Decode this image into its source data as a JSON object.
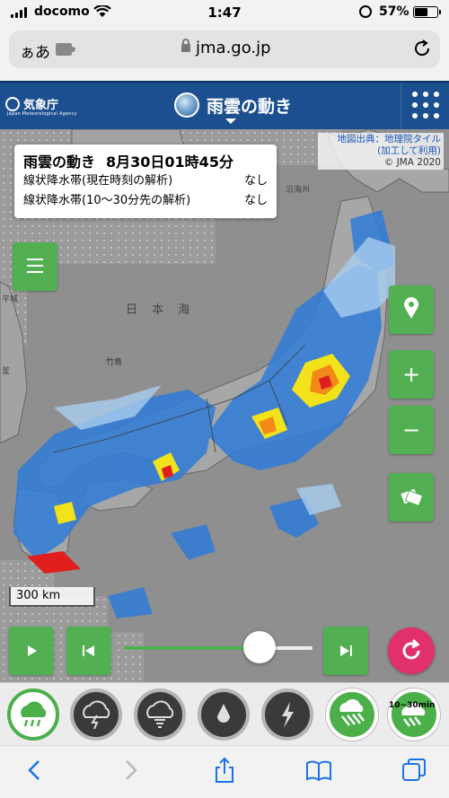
{
  "status_bar": {
    "carrier": "docomo",
    "time": "1:47",
    "battery": "57%",
    "battery_level": 0.57
  },
  "browser": {
    "text_size_label": "ぁあ",
    "domain": "jma.go.jp"
  },
  "header": {
    "agency_name": "気象庁",
    "agency_name_en": "Japan Meteorological Agency",
    "title": "雨雲の動き"
  },
  "map": {
    "attribution_line1": "地図出典：地理院タイル",
    "attribution_line2": "(加工して利用)",
    "attribution_line3": "© JMA 2020",
    "info": {
      "title": "雨雲の動き",
      "datetime": "8月30日01時45分",
      "rows": [
        {
          "label": "線状降水帯(現在時刻の解析)",
          "value": "なし"
        },
        {
          "label": "線状降水帯(10〜30分先の解析)",
          "value": "なし"
        }
      ]
    },
    "place_labels": {
      "sea": "日 本 海",
      "island": "竹島",
      "north": "沿海州",
      "korea": "平城",
      "kr_south": "釜"
    },
    "scale_label": "300 km",
    "timeline_progress": 0.72
  },
  "layers": {
    "items": [
      {
        "icon": "rain-cloud-icon",
        "state": "active"
      },
      {
        "icon": "thunder-cloud-icon",
        "state": "dark"
      },
      {
        "icon": "tornado-cloud-icon",
        "state": "dark"
      },
      {
        "icon": "raindrop-icon",
        "state": "dark"
      },
      {
        "icon": "lightning-icon",
        "state": "dark"
      },
      {
        "icon": "linear-rainband-icon",
        "state": "green"
      },
      {
        "icon": "linear-rainband-forecast-icon",
        "state": "green"
      }
    ],
    "forecast_tag": "10~30min"
  },
  "colors": {
    "header_blue": "#1c4f8f",
    "button_green": "#52b052",
    "reload_pink": "#e2306c"
  }
}
